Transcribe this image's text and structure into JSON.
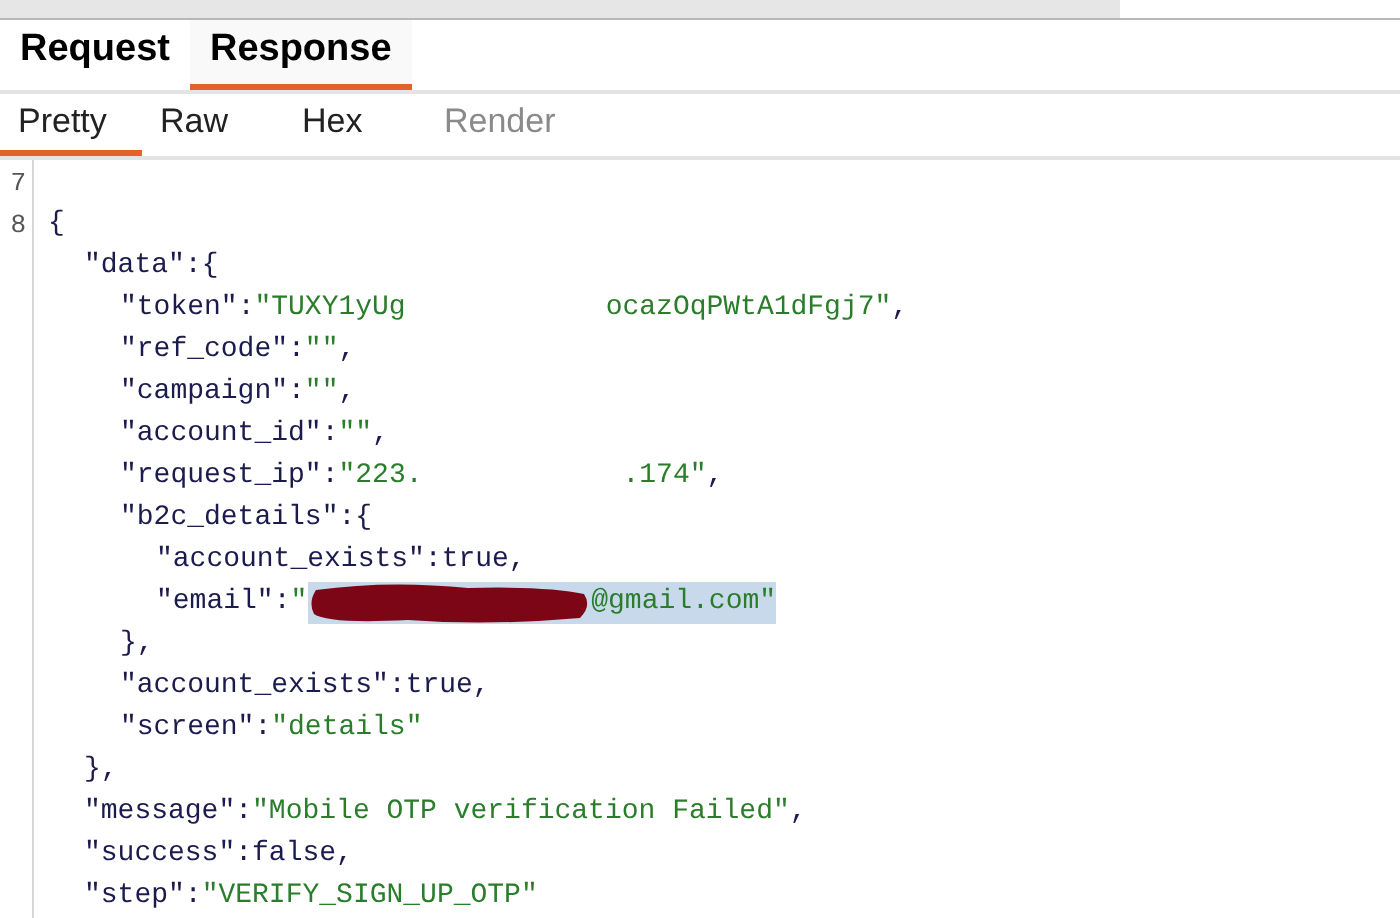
{
  "tabs": [
    {
      "label": "Request",
      "selected": false
    },
    {
      "label": "Response",
      "selected": true
    }
  ],
  "view_tabs": [
    {
      "label": "Pretty",
      "selected": true,
      "disabled": false
    },
    {
      "label": "Raw",
      "selected": false,
      "disabled": false
    },
    {
      "label": "Hex",
      "selected": false,
      "disabled": false
    },
    {
      "label": "Render",
      "selected": false,
      "disabled": true
    }
  ],
  "line_numbers": [
    "7",
    "8"
  ],
  "code": [
    {
      "segments": [
        {
          "kind": "punct",
          "text": "{",
          "selected": false
        }
      ],
      "children": [
        {
          "segments": [
            {
              "kind": "key",
              "text": "\"data\"",
              "selected": false
            },
            {
              "kind": "punct",
              "text": ":{",
              "selected": false
            }
          ],
          "children": [
            {
              "segments": [
                {
                  "kind": "key",
                  "text": "\"token\"",
                  "selected": false
                },
                {
                  "kind": "punct",
                  "text": ":",
                  "selected": false
                },
                {
                  "kind": "string",
                  "text": "\"TUXY1yUg",
                  "selected": false
                },
                {
                  "kind": "gap",
                  "selected": false
                },
                {
                  "kind": "string",
                  "text": "ocazOqPWtA1dFgj7\"",
                  "selected": false
                },
                {
                  "kind": "punct",
                  "text": ",",
                  "selected": false
                }
              ]
            },
            {
              "segments": [
                {
                  "kind": "key",
                  "text": "\"ref_code\"",
                  "selected": false
                },
                {
                  "kind": "punct",
                  "text": ":",
                  "selected": false
                },
                {
                  "kind": "string",
                  "text": "\"\"",
                  "selected": false
                },
                {
                  "kind": "punct",
                  "text": ",",
                  "selected": false
                }
              ]
            },
            {
              "segments": [
                {
                  "kind": "key",
                  "text": "\"campaign\"",
                  "selected": false
                },
                {
                  "kind": "punct",
                  "text": ":",
                  "selected": false
                },
                {
                  "kind": "string",
                  "text": "\"\"",
                  "selected": false
                },
                {
                  "kind": "punct",
                  "text": ",",
                  "selected": false
                }
              ]
            },
            {
              "segments": [
                {
                  "kind": "key",
                  "text": "\"account_id\"",
                  "selected": false
                },
                {
                  "kind": "punct",
                  "text": ":",
                  "selected": false
                },
                {
                  "kind": "string",
                  "text": "\"\"",
                  "selected": false
                },
                {
                  "kind": "punct",
                  "text": ",",
                  "selected": false
                }
              ]
            },
            {
              "segments": [
                {
                  "kind": "key",
                  "text": "\"request_ip\"",
                  "selected": false
                },
                {
                  "kind": "punct",
                  "text": ":",
                  "selected": false
                },
                {
                  "kind": "string",
                  "text": "\"223.",
                  "selected": false
                },
                {
                  "kind": "gap",
                  "selected": false
                },
                {
                  "kind": "string",
                  "text": ".174\"",
                  "selected": false
                },
                {
                  "kind": "punct",
                  "text": ",",
                  "selected": false
                }
              ]
            },
            {
              "segments": [
                {
                  "kind": "key",
                  "text": "\"b2c_details\"",
                  "selected": false
                },
                {
                  "kind": "punct",
                  "text": ":{",
                  "selected": false
                }
              ],
              "children": [
                {
                  "segments": [
                    {
                      "kind": "key",
                      "text": "\"account_exists\"",
                      "selected": false
                    },
                    {
                      "kind": "punct",
                      "text": ":true,",
                      "selected": false
                    }
                  ]
                },
                {
                  "segments": [
                    {
                      "kind": "key",
                      "text": "\"email\"",
                      "selected": false
                    },
                    {
                      "kind": "punct",
                      "text": ":",
                      "selected": false
                    },
                    {
                      "kind": "string",
                      "text": "\"",
                      "selected": false
                    },
                    {
                      "kind": "scribble",
                      "selected": true
                    },
                    {
                      "kind": "string",
                      "text": "@gmail.com\"",
                      "selected": true
                    }
                  ]
                }
              ]
            },
            {
              "segments": [
                {
                  "kind": "punct",
                  "text": "},",
                  "selected": false
                }
              ]
            },
            {
              "segments": [
                {
                  "kind": "key",
                  "text": "\"account_exists\"",
                  "selected": false
                },
                {
                  "kind": "punct",
                  "text": ":true,",
                  "selected": false
                }
              ]
            },
            {
              "segments": [
                {
                  "kind": "key",
                  "text": "\"screen\"",
                  "selected": false
                },
                {
                  "kind": "punct",
                  "text": ":",
                  "selected": false
                },
                {
                  "kind": "string",
                  "text": "\"details\"",
                  "selected": false
                }
              ]
            }
          ]
        },
        {
          "segments": [
            {
              "kind": "punct",
              "text": "},",
              "selected": false
            }
          ]
        },
        {
          "segments": [
            {
              "kind": "key",
              "text": "\"message\"",
              "selected": false
            },
            {
              "kind": "punct",
              "text": ":",
              "selected": false
            },
            {
              "kind": "string",
              "text": "\"Mobile OTP verification Failed\"",
              "selected": false
            },
            {
              "kind": "punct",
              "text": ",",
              "selected": false
            }
          ]
        },
        {
          "segments": [
            {
              "kind": "key",
              "text": "\"success\"",
              "selected": false
            },
            {
              "kind": "punct",
              "text": ":false,",
              "selected": false
            }
          ]
        },
        {
          "segments": [
            {
              "kind": "key",
              "text": "\"step\"",
              "selected": false
            },
            {
              "kind": "punct",
              "text": ":",
              "selected": false
            },
            {
              "kind": "string",
              "text": "\"VERIFY_SIGN_UP_OTP\"",
              "selected": false
            }
          ]
        }
      ]
    }
  ]
}
